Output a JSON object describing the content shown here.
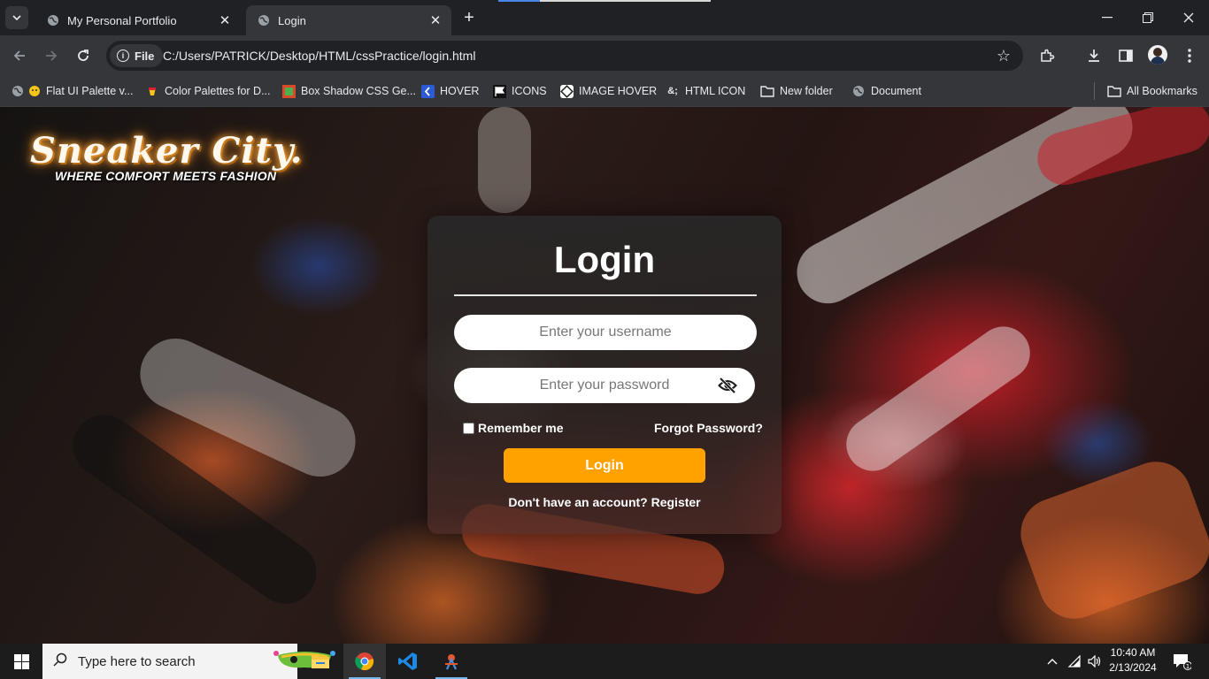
{
  "browser": {
    "tabs": [
      {
        "title": "My Personal Portfolio",
        "active": false,
        "icon": "globe-icon"
      },
      {
        "title": "Login",
        "active": true,
        "icon": "globe-icon"
      }
    ],
    "site_chip": "File",
    "url": "C:/Users/PATRICK/Desktop/HTML/cssPractice/login.html",
    "bookmarks": [
      {
        "label": "Flat UI Palette v...",
        "icon": "globe-icon"
      },
      {
        "label": "Color Palettes for D...",
        "icon": "palette-icon"
      },
      {
        "label": "Box Shadow CSS Ge...",
        "icon": "box-shadow-icon"
      },
      {
        "label": "HOVER",
        "icon": "hover-icon"
      },
      {
        "label": "ICONS",
        "icon": "flag-icon"
      },
      {
        "label": "IMAGE HOVER",
        "icon": "image-hover-icon"
      },
      {
        "label": "HTML ICON",
        "icon": "html-entity-icon"
      },
      {
        "label": "New folder",
        "icon": "folder-icon"
      },
      {
        "label": "Document",
        "icon": "globe-icon"
      }
    ],
    "all_bookmarks": "All Bookmarks"
  },
  "page": {
    "brand_title": "Sneaker City.",
    "brand_tagline": "WHERE COMFORT MEETS FASHION",
    "login": {
      "title": "Login",
      "username_placeholder": "Enter your username",
      "password_placeholder": "Enter your password",
      "remember_label": "Remember me",
      "forgot_label": "Forgot Password?",
      "button_label": "Login",
      "signup_text": "Don't have an account?",
      "register_label": "Register"
    }
  },
  "taskbar": {
    "search_placeholder": "Type here to search",
    "time": "10:40 AM",
    "date": "2/13/2024"
  },
  "colors": {
    "accent_button": "#ffa200",
    "chrome_bg": "#35363a"
  }
}
